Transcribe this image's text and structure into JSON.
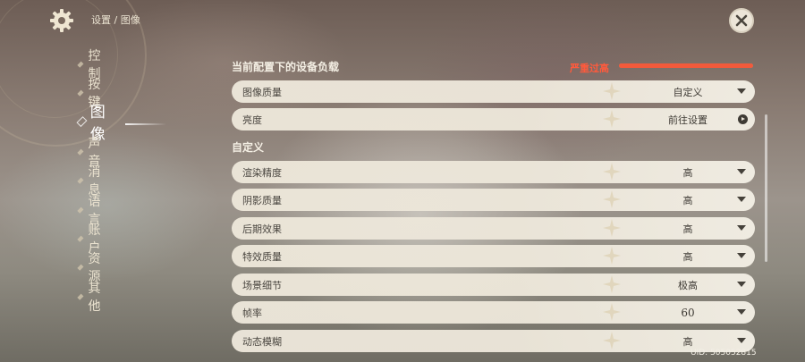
{
  "header": {
    "breadcrumb": "设置 / 图像",
    "settings_icon": "gear-icon",
    "close_icon": "close-icon"
  },
  "nav": {
    "items": [
      {
        "label": "控制",
        "active": false
      },
      {
        "label": "按键",
        "active": false
      },
      {
        "label": "图像",
        "active": true
      },
      {
        "label": "声音",
        "active": false
      },
      {
        "label": "消息",
        "active": false
      },
      {
        "label": "语言",
        "active": false
      },
      {
        "label": "账户",
        "active": false
      },
      {
        "label": "资源",
        "active": false
      },
      {
        "label": "其他",
        "active": false
      }
    ]
  },
  "device_load": {
    "title": "当前配置下的设备负载",
    "status": "严重过高",
    "level": 1.0,
    "color": "#f25a3b"
  },
  "main_rows": [
    {
      "label": "图像质量",
      "value": "自定义",
      "control": "dropdown"
    },
    {
      "label": "亮度",
      "value": "前往设置",
      "control": "goto"
    }
  ],
  "custom_section": {
    "title": "自定义",
    "rows": [
      {
        "label": "渲染精度",
        "value": "高"
      },
      {
        "label": "阴影质量",
        "value": "高"
      },
      {
        "label": "后期效果",
        "value": "高"
      },
      {
        "label": "特效质量",
        "value": "高"
      },
      {
        "label": "场景细节",
        "value": "极高"
      },
      {
        "label": "帧率",
        "value": "60"
      },
      {
        "label": "动态模糊",
        "value": "高"
      }
    ]
  },
  "footer": {
    "uid": "UID: 505052815"
  }
}
